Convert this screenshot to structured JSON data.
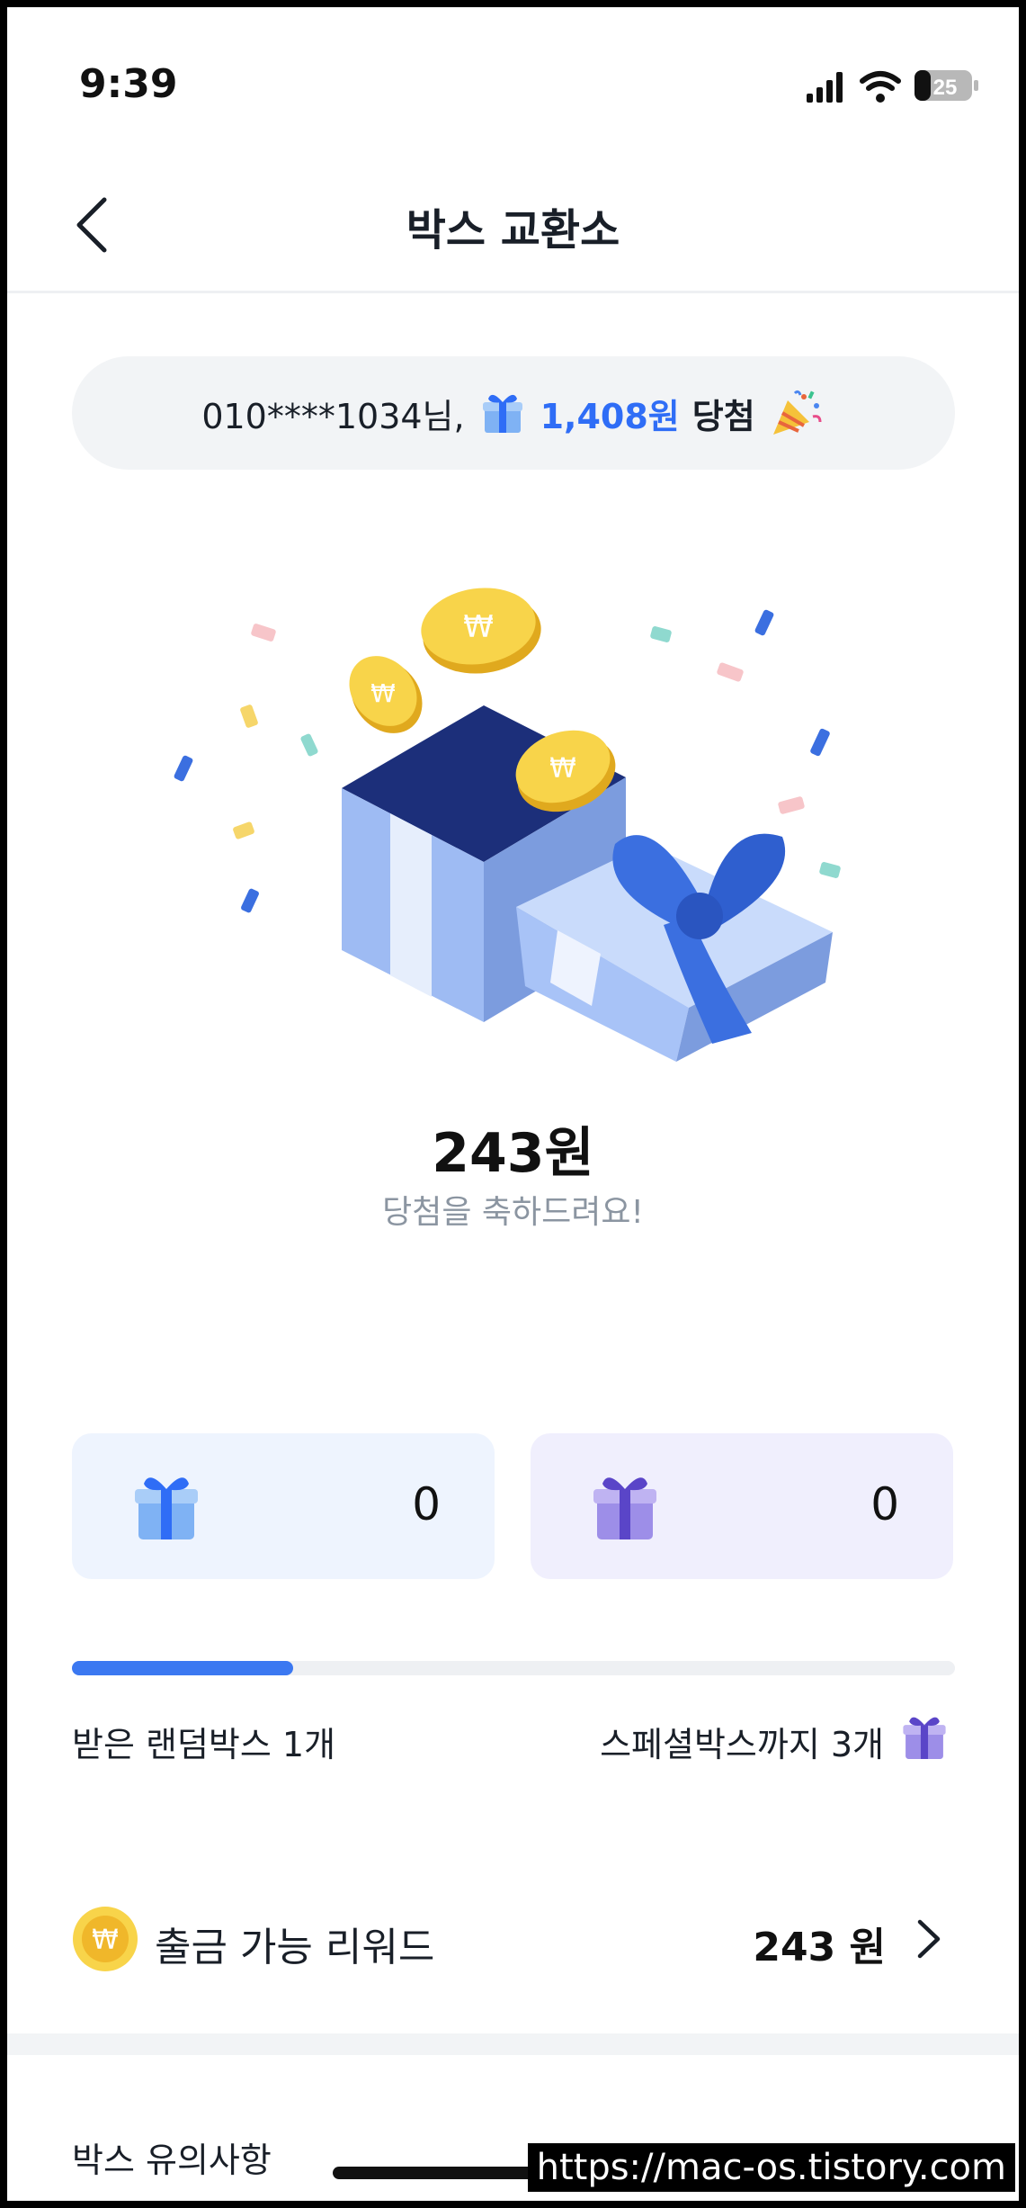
{
  "status_bar": {
    "time": "9:39",
    "battery": "25"
  },
  "nav": {
    "title": "박스 교환소"
  },
  "winner_banner": {
    "user": "010****1034님,",
    "amount": "1,408원",
    "suffix": "당첨"
  },
  "prize": {
    "amount": "243원",
    "message": "당첨을 축하드려요!"
  },
  "box_counts": {
    "random": "0",
    "special": "0"
  },
  "progress": {
    "fraction": 0.25,
    "left_label": "받은 랜덤박스 1개",
    "right_label": "스페셜박스까지 3개"
  },
  "reward": {
    "label": "출금 가능 리워드",
    "value": "243 원"
  },
  "notice": {
    "title": "박스 유의사항"
  },
  "watermark": "https://mac-os.tistory.com",
  "colors": {
    "accent": "#3b78f1",
    "random_card": "#eef4fe",
    "special_card": "#f0effd"
  },
  "icons": [
    "chevron-left-icon",
    "gift-box-icon",
    "party-popper-icon",
    "coin-icon",
    "chevron-right-icon"
  ]
}
